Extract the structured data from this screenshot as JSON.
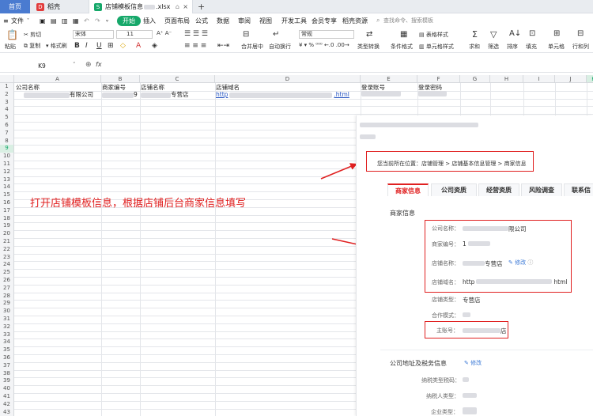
{
  "tabs": {
    "home": "首页",
    "daoke": "稻壳",
    "file": "店铺模板信息",
    "file_ext": ".xlsx",
    "add": "+"
  },
  "menu": {
    "file": "文件",
    "start": "开始",
    "items": [
      "插入",
      "页面布局",
      "公式",
      "数据",
      "审阅",
      "视图",
      "开发工具",
      "会员专享",
      "稻壳资源"
    ],
    "search_placeholder": "查找命令、搜索模板"
  },
  "ribbon": {
    "cut": "剪切",
    "paste": "粘贴",
    "copy": "复制",
    "format_painter": "格式刷",
    "font": "宋体",
    "size": "11",
    "number_format": "常规",
    "merge": "合并居中",
    "wrap": "自动换行",
    "type_convert": "类型转换",
    "cond_format": "条件格式",
    "table_style": "表格样式",
    "cell_style": "单元格样式",
    "sum": "求和",
    "filter": "筛选",
    "sort": "排序",
    "fill": "填充",
    "cell": "单元格",
    "row_col": "行和列"
  },
  "formula": {
    "cell_ref": "K9",
    "fx": "fx"
  },
  "grid": {
    "columns": [
      "A",
      "B",
      "C",
      "D",
      "E",
      "F",
      "G",
      "H",
      "I",
      "J",
      "K"
    ],
    "rows": 43,
    "header": {
      "A": "公司名称",
      "B": "商家编号",
      "C": "店铺名称",
      "D": "店铺域名",
      "E": "登录账号",
      "F": "登录密码"
    },
    "row2": {
      "A": "有限公司",
      "B": "9",
      "C": "专营店",
      "D_prefix": "http",
      "D_suffix": ".html"
    }
  },
  "annotation": "打开店铺模板信息，根据店铺后台商家信息填写",
  "panel": {
    "breadcrumb": "您当前所在位置：店铺管理 > 店铺基本信息管理 > 商家信息",
    "tabs": [
      "商家信息",
      "公司资质",
      "经营资质",
      "风险调查",
      "联系信"
    ],
    "section_title": "商家信息",
    "company_label": "公司名称：",
    "company_value": "限公司",
    "merchant_no_label": "商家编号：",
    "merchant_no_value": "1",
    "shop_name_label": "店铺名称：",
    "shop_name_value": "专营店",
    "edit": "修改",
    "domain_label": "店铺域名：",
    "domain_prefix": "http",
    "domain_suffix": "html",
    "shop_type_label": "店铺类型：",
    "shop_type_value": "专营店",
    "coop_label": "合作模式：",
    "main_acct_label": "主账号：",
    "main_acct_value": "店",
    "tax_title": "公司地址及税务信息",
    "taxpayer_no_label": "纳税类型税码：",
    "taxpayer_type_label": "纳税人类型：",
    "company_type_label": "企业类型："
  },
  "colors": {
    "accent_green": "#16a86a",
    "annotation_red": "#e02020",
    "home_tab": "#4a7bd0"
  }
}
